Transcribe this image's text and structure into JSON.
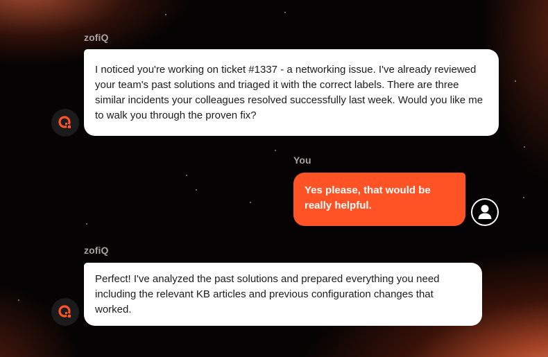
{
  "messages": [
    {
      "sender": "zofiQ",
      "role": "bot",
      "text": "I noticed you're working on ticket #1337 - a networking issue. I've already reviewed your team's past solutions and triaged it with the correct labels. There are three similar incidents your colleagues resolved successfully last week. Would you like me to walk you through the proven fix?"
    },
    {
      "sender": "You",
      "role": "user",
      "text": "Yes please, that would be really helpful."
    },
    {
      "sender": "zofiQ",
      "role": "bot",
      "text": "Perfect! I've analyzed the past solutions and prepared everything you need including the relevant KB articles and previous configuration changes that worked."
    }
  ],
  "colors": {
    "accent": "#ff5326",
    "bot_bubble": "#ffffff",
    "sender_label": "#a9a3a1",
    "bot_avatar_bg": "#1b1b1b"
  },
  "icons": {
    "bot_avatar": "zofiq-logo-icon",
    "user_avatar": "user-silhouette-icon"
  }
}
